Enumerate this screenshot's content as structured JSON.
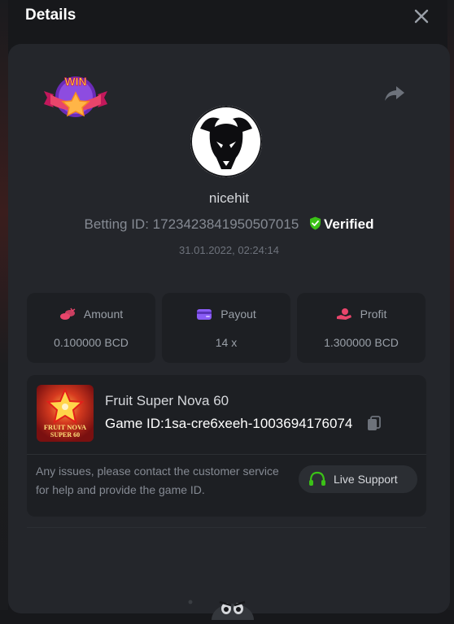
{
  "header": {
    "title": "Details"
  },
  "player": {
    "username": "nicehit",
    "betting_id_label": "Betting ID:",
    "betting_id": "1723423841950507015",
    "verified_label": "Verified",
    "timestamp": "31.01.2022, 02:24:14"
  },
  "badge": {
    "text": "WIN"
  },
  "stats": [
    {
      "label": "Amount",
      "value": "0.100000 BCD",
      "icon": "coins-icon",
      "color": "#e8456b"
    },
    {
      "label": "Payout",
      "value": "14 x",
      "icon": "wallet-card-icon",
      "color": "#8a5cf6"
    },
    {
      "label": "Profit",
      "value": "1.300000 BCD",
      "icon": "hand-coin-icon",
      "color": "#e8456b"
    }
  ],
  "game": {
    "name": "Fruit Super Nova 60",
    "id_label": "Game ID:",
    "id": "1sa-cre6xeeh-1003694176074",
    "thumb_line1": "FRUIT NOVA",
    "thumb_line2": "SUPER 60",
    "notice": "Any issues, please contact the customer service for help and provide the game ID.",
    "support_label": "Live Support"
  },
  "colors": {
    "background": "#17181b",
    "card": "#24262b",
    "box": "#1d1f23",
    "verified": "#3bc117",
    "support_icon": "#3bc117"
  }
}
